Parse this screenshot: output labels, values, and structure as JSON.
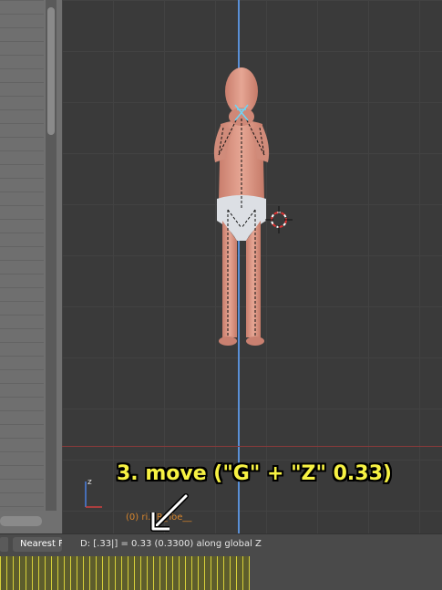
{
  "annotation": {
    "text": "3. move (\"G\" + \"Z\" 0.33)"
  },
  "viewport": {
    "object_label": "(0) ri...R_Toe__"
  },
  "status_bar": {
    "text": "D: [.33|] = 0.33 (0.3300) along global Z"
  },
  "left_panel": {
    "nearest_button": "Nearest F"
  },
  "colors": {
    "annotation": "#f7f243",
    "axis_z": "#5a8fd6",
    "axis_x": "#8a3a3a",
    "object_label": "#d9862c"
  },
  "icons": [
    "axis-gizmo-icon",
    "3d-cursor-icon",
    "arrow-icon"
  ]
}
